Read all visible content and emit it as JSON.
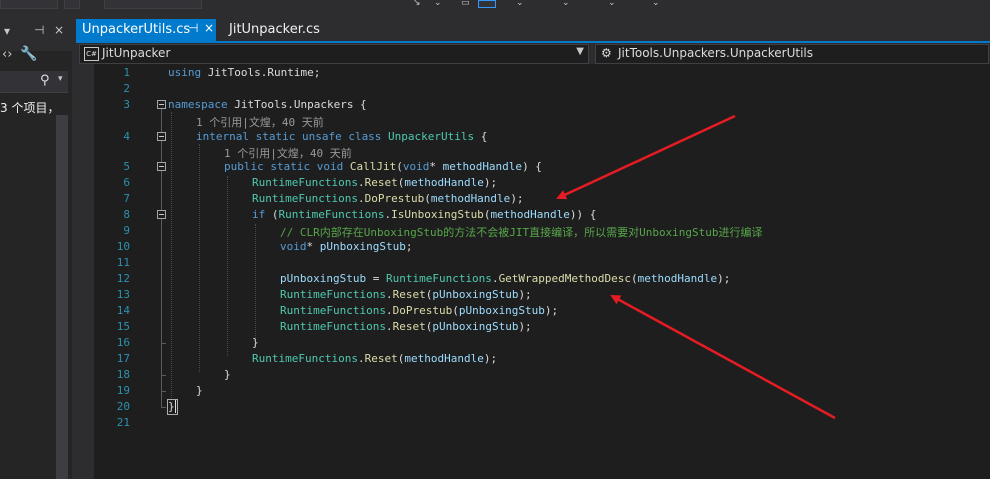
{
  "left_panel": {
    "item_text": "3 个项目，"
  },
  "tabs": [
    {
      "label": "UnpackerUtils.cs",
      "active": true,
      "pin": "⊣",
      "close": "×"
    },
    {
      "label": "JitUnpacker.cs",
      "active": false
    }
  ],
  "navbar": {
    "project": "JitUnpacker",
    "type": "JitTools.Unpackers.UnpackerUtils"
  },
  "line_numbers": [
    "1",
    "2",
    "3",
    "4",
    "5",
    "6",
    "7",
    "8",
    "9",
    "10",
    "11",
    "12",
    "13",
    "14",
    "15",
    "16",
    "17",
    "18",
    "19",
    "20",
    "21"
  ],
  "codelens": {
    "class_info": "1 个引用|文煌，40 天前",
    "method_info": "1 个引用|文煌，40 天前"
  },
  "code": {
    "l1_kw": "using",
    "l1_rest": " JitTools.Runtime;",
    "l3_kw": "namespace",
    "l3_rest": " JitTools.Unpackers {",
    "l4_kw": "internal static unsafe class",
    "l4_type": " UnpackerUtils",
    "l4_rest": " {",
    "l5_kw": "public static void",
    "l5_fn": " CallJit",
    "l5_p1": "(",
    "l5_kw2": "void",
    "l5_p2": "* ",
    "l5_param": "methodHandle",
    "l5_p3": ") {",
    "l6_type": "RuntimeFunctions",
    "l6_dot": ".",
    "l6_fn": "Reset",
    "l6_open": "(",
    "l6_arg": "methodHandle",
    "l6_close": ");",
    "l7_type": "RuntimeFunctions",
    "l7_dot": ".",
    "l7_fn": "DoPrestub",
    "l7_open": "(",
    "l7_arg": "methodHandle",
    "l7_close": ");",
    "l8_kw": "if",
    "l8_open": " (",
    "l8_type": "RuntimeFunctions",
    "l8_dot": ".",
    "l8_fn": "IsUnboxingStub",
    "l8_open2": "(",
    "l8_arg": "methodHandle",
    "l8_close": ")) {",
    "l9_comment": "// CLR内部存在UnboxingStub的方法不会被JIT直接编译，所以需要对UnboxingStub进行编译",
    "l10_kw": "void",
    "l10_star": "* ",
    "l10_var": "pUnboxingStub",
    "l10_semi": ";",
    "l12_var": "pUnboxingStub",
    "l12_eq": " = ",
    "l12_type": "RuntimeFunctions",
    "l12_dot": ".",
    "l12_fn": "GetWrappedMethodDesc",
    "l12_open": "(",
    "l12_arg": "methodHandle",
    "l12_close": ");",
    "l13_type": "RuntimeFunctions",
    "l13_dot": ".",
    "l13_fn": "Reset",
    "l13_open": "(",
    "l13_arg": "pUnboxingStub",
    "l13_close": ");",
    "l14_type": "RuntimeFunctions",
    "l14_dot": ".",
    "l14_fn": "DoPrestub",
    "l14_open": "(",
    "l14_arg": "pUnboxingStub",
    "l14_close": ");",
    "l15_type": "RuntimeFunctions",
    "l15_dot": ".",
    "l15_fn": "Reset",
    "l15_open": "(",
    "l15_arg": "pUnboxingStub",
    "l15_close": ");",
    "l16": "}",
    "l17_type": "RuntimeFunctions",
    "l17_dot": ".",
    "l17_fn": "Reset",
    "l17_open": "(",
    "l17_arg": "methodHandle",
    "l17_close": ");",
    "l18": "}",
    "l19": "}",
    "l20": "}"
  },
  "colors": {
    "accent": "#007acc",
    "keyword": "#569cd6",
    "type": "#4ec9b0",
    "method": "#dcdcaa",
    "parameter": "#9cdcfe",
    "comment": "#57a64a",
    "line_number": "#2b91af",
    "arrow": "#e51c23"
  },
  "icons": {
    "toolbar_overflow": "overflow-arrow-icon",
    "pin": "pin-icon",
    "wrench": "wrench-icon",
    "search": "search-icon",
    "csharp_file": "csharp-file-icon",
    "class": "class-icon"
  }
}
